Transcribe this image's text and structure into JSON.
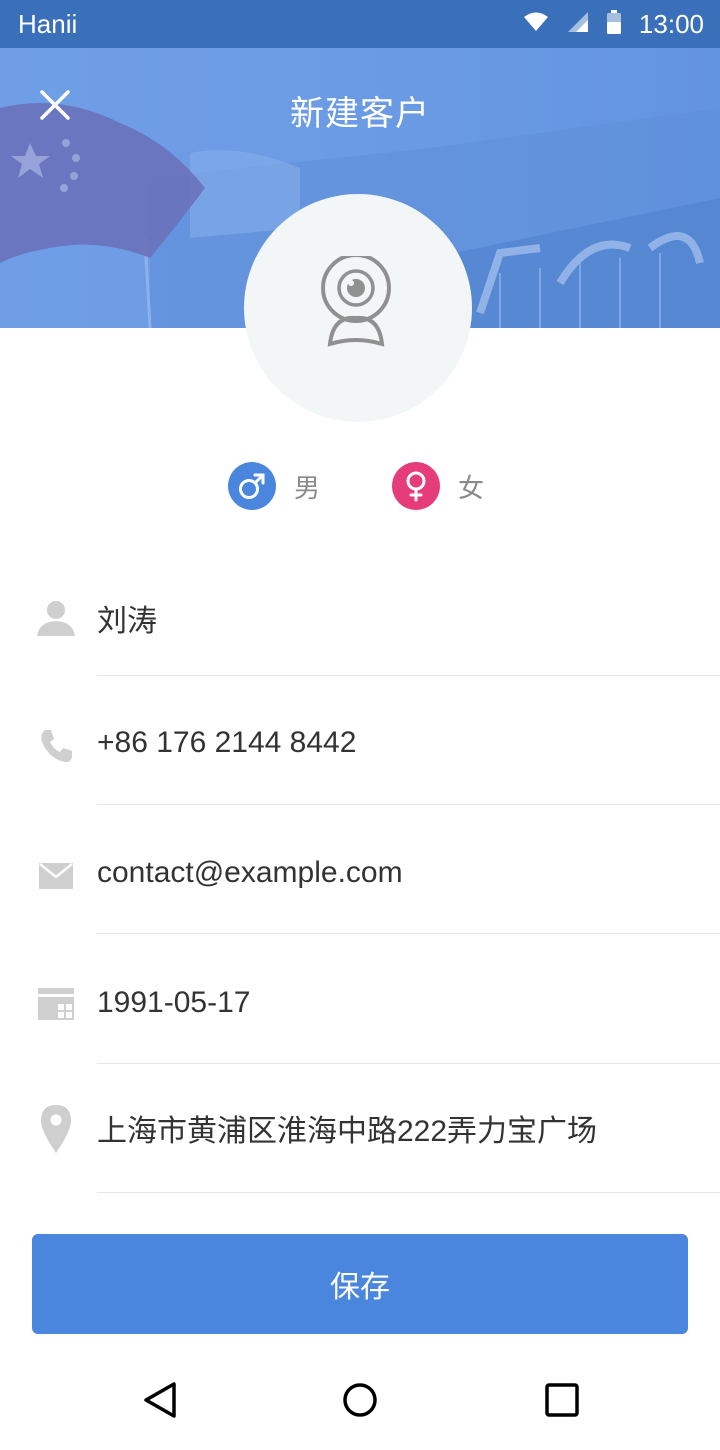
{
  "status_bar": {
    "carrier": "Hanii",
    "time": "13:00",
    "icons": [
      "wifi-icon",
      "signal-icon",
      "battery-icon"
    ]
  },
  "header": {
    "title": "新建客户",
    "close_icon": "close-icon"
  },
  "avatar": {
    "icon": "camera-icon"
  },
  "gender": {
    "male_label": "男",
    "female_label": "女",
    "male_color": "#4a86dd",
    "female_color": "#e63d7a"
  },
  "form": {
    "name": "刘涛",
    "phone": "+86 176 2144 8442",
    "email": "contact@example.com",
    "birthday": "1991-05-17",
    "address": "上海市黄浦区淮海中路222弄力宝广场"
  },
  "save_button": {
    "label": "保存",
    "color": "#4a86dd"
  },
  "nav": {
    "icons": [
      "back-icon",
      "home-icon",
      "recents-icon"
    ]
  }
}
